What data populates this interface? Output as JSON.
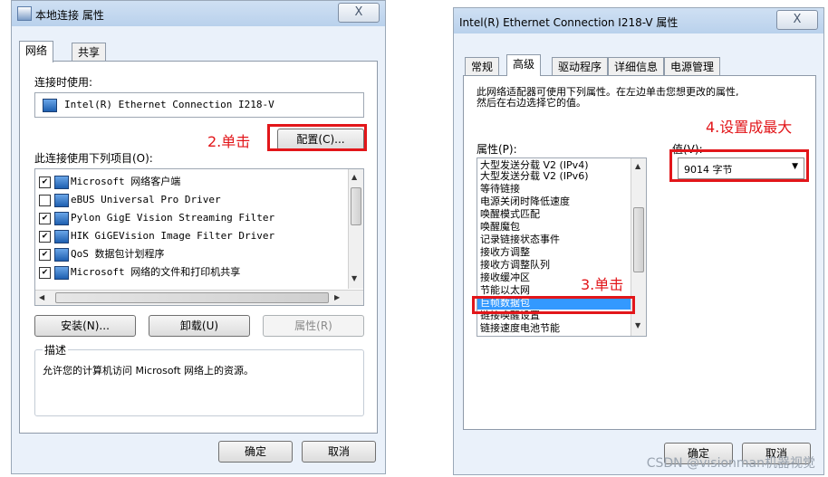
{
  "left_dialog": {
    "title": "本地连接 属性",
    "close_label": "X",
    "tabs": [
      "网络",
      "共享"
    ],
    "connect_using_label": "连接时使用:",
    "adapter_name": "Intel(R) Ethernet Connection I218-V",
    "configure_label": "配置(C)...",
    "items_label": "此连接使用下列项目(O):",
    "items": [
      {
        "label": "Microsoft 网络客户端",
        "checked": true
      },
      {
        "label": "eBUS Universal Pro Driver",
        "checked": false
      },
      {
        "label": "Pylon GigE Vision Streaming Filter",
        "checked": true
      },
      {
        "label": "HIK GiGEVision Image Filter Driver",
        "checked": true
      },
      {
        "label": "QoS 数据包计划程序",
        "checked": true
      },
      {
        "label": "Microsoft 网络的文件和打印机共享",
        "checked": true
      }
    ],
    "install_label": "安装(N)...",
    "uninstall_label": "卸载(U)",
    "properties_label": "属性(R)",
    "description_label": "描述",
    "description_text": "允许您的计算机访问 Microsoft 网络上的资源。",
    "ok_label": "确定",
    "cancel_label": "取消",
    "annotation": "2.单击"
  },
  "right_dialog": {
    "title": "Intel(R) Ethernet Connection I218-V 属性",
    "close_label": "X",
    "tabs": [
      "常规",
      "高级",
      "驱动程序",
      "详细信息",
      "电源管理"
    ],
    "intro_text_1": "此网络适配器可使用下列属性。在左边单击您想更改的属性,",
    "intro_text_2": "然后在右边选择它的值。",
    "property_label": "属性(P):",
    "value_label": "值(V):",
    "properties": [
      "大型发送分载 V2 (IPv4)",
      "大型发送分载 V2 (IPv6)",
      "等待链接",
      "电源关闭时降低速度",
      "唤醒模式匹配",
      "唤醒魔包",
      "记录链接状态事件",
      "接收方调整",
      "接收方调整队列",
      "接收缓冲区",
      "节能以太网",
      "巨帧数据包",
      "链接唤醒设置",
      "链接速度电池节能"
    ],
    "selected_property": "巨帧数据包",
    "value_selected": "9014 字节",
    "ok_label": "确定",
    "cancel_label": "取消",
    "annotation_click": "3.单击",
    "annotation_max": "4.设置成最大"
  },
  "watermark": "CSDN @visionman机器视觉",
  "colors": {
    "annotation": "#e2161a",
    "selection": "#3399ff"
  }
}
